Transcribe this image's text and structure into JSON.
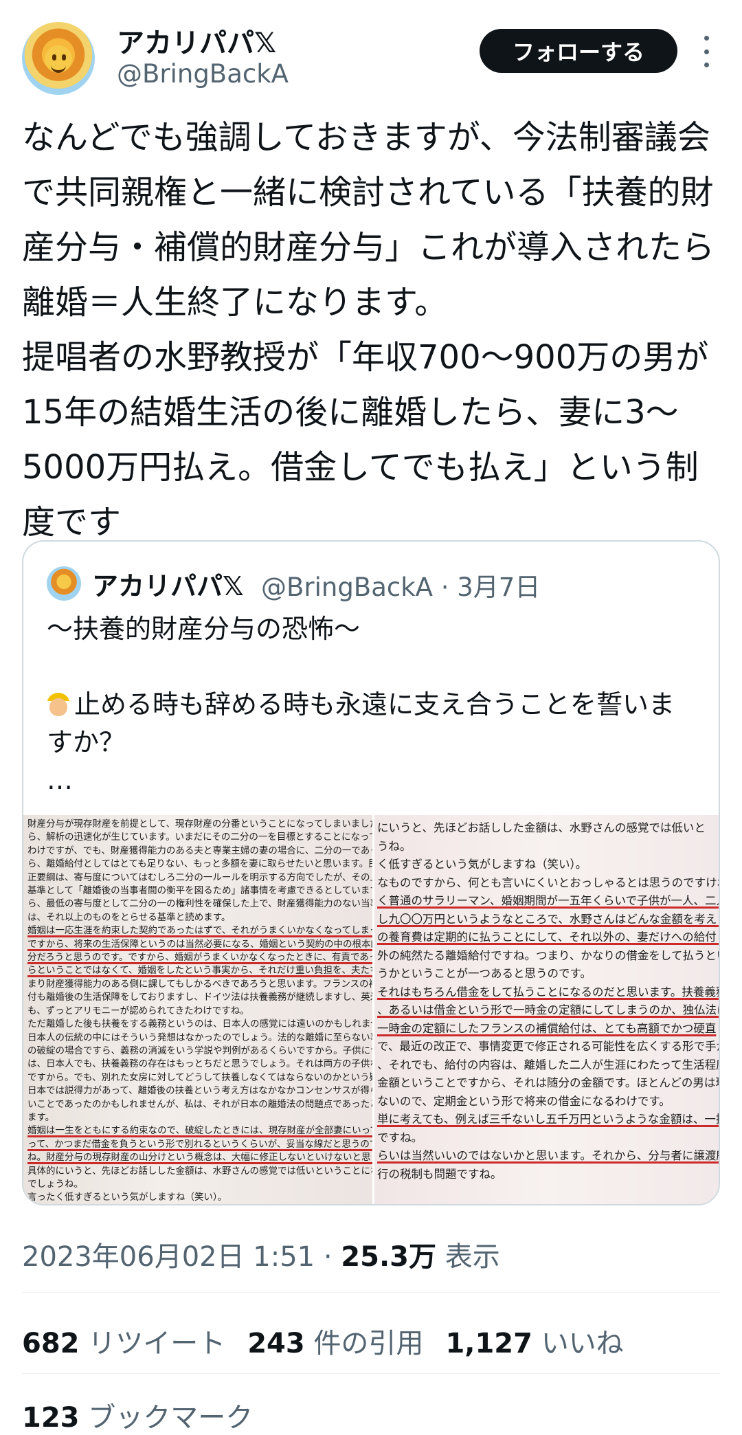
{
  "author": {
    "display_name": "アカリパパ𝕏",
    "handle": "@BringBackA"
  },
  "follow_button_label": "フォローする",
  "tweet_text": "なんどでも強調しておきますが、今法制審議会で共同親権と一緒に検討されている「扶養的財産分与・補償的財産分与」これが導入されたら離婚＝人生終了になります。\n提唱者の水野教授が「年収700〜900万の男が15年の結婚生活の後に離婚したら、妻に3〜5000万円払え。借金してでも払え」という制度です",
  "quoted_tweet": {
    "display_name": "アカリパパ𝕏",
    "meta": "@BringBackA · 3月7日",
    "line1": "〜扶養的財産分与の恐怖〜",
    "line2": "止める時も辞める時も永遠に支え合うことを誓いますか？",
    "ellipsis": "…",
    "doc_left_lines": [
      "財産分与が現存財産を前提として、現存財産の分番ということになってしまいましたか",
      "ら、解析の迅速化が生じています。いまだにその二分の一を目標とすることになってい",
      "わけですが、でも、財産獲得能力のある夫と専業主婦の妻の場合に、二分の一であっ",
      "ら、離婚給付としてはとても足りない、もっと多額を妻に取らせたいと思います。民法",
      "正要綱は、寄与度についてはむしろ二分の一ルールを明示する方向でしたが、その上",
      "基準として「離婚後の当事者間の衡平を図るため」諸事情を考慮できるとしていますが",
      "ら、最低の寄与度として二分の一の権利性を確保した上で、財産獲得能力のない当事者",
      "は、それ以上のものをとらせる基準と読めます。",
      "婚姻は一応生涯を約束した契約であったはずで、それがうまくいかなくなってしまった",
      "ですから、将来の生活保障というのは当然必要になる、婚姻という契約の中の根本的な",
      "分だろうと思うのです。ですから、婚姻がうまくいかなくなったときに、有責であった",
      "らということではなくて、婚姻をしたという事実から、それだけ重い負担を、夫たち",
      "まり財産獲得能力のある側に課してもしかるべきであろうと思います。フランスの補償",
      "付も離婚後の生活保障をしておりますし、ドイツ法は扶養義務が継続しますし、英米法",
      "も、ずっとアリモニーが認められてきたわけですね。",
      "ただ離婚した後も扶養をする義務というのは、日本人の感覚には遠いのかもしれませ",
      "日本人の伝統の中にはそういう発想はなかったのでしょう。法的な離婚に至らない事実",
      "の破綻の場合ですら、義務の消滅をいう学説や判例があるくらいですから。子供につい",
      "は、日本人でも、扶養義務の存在はもっとちだと思うでしょう。それは両方の子供なわ",
      "ですから。でも、別れた女房に対してどうして扶養しなくてはならないのかという疑問",
      "日本では説得力があって、離婚後の扶養という考え方はなかなかコンセンサスが得られ",
      "いことであったのかもしれませんが、私は、それが日本の離婚法の問題点であったと思",
      "ます。",
      "婚姻は一生をともにする約束なので、破綻したときには、現存財産が全部妻にいってし",
      "って、かつまだ借金を負うという形で別れるというくらいが、妥当な線だと思うので",
      "ね。財産分与の現存財産の山分けという概念は、大幅に修正しないといけないと思う。",
      "具体的にいうと、先ほどお話しした金額は、水野さんの感覚では低いということになる",
      "でしょうね。",
      "言ったく低すぎるという気がしますね（笑い）。"
    ],
    "doc_right_lines": [
      "にいうと、先ほどお話しした金額は、水野さんの感覚では低いと",
      "うね。",
      "く低すぎるという気がしますね（笑い）。",
      "なものですから、何とも言いにくいとおっしゃるとは思うのですけれ",
      "く普通のサラリーマン、婚姻期間が一五年くらいで子供が一人、二人",
      "し九〇〇万円というようなところで、水野さんはどんな金額を考えら",
      "の養育費は定期的に払うことにして、それ以外の、妻だけへの給付と",
      "外の純然たる離婚給付ですね。つまり、かなりの借金をして払うとい",
      "うかということが一つあると思うのです。",
      "それはもちろん借金をして払うことになるのだと思います。扶養義務",
      "、あるいは借金という形で一時金の定額にしてしまうのか、独仏法に",
      "一時金の定額にしたフランスの補償給付は、とても高額でかつ硬直",
      "で、最近の改正で、事情変更で修正される可能性を広くする形で手が",
      "、それでも、給付の内容は、離婚した二人が生涯にわたって生活程度",
      "金額ということですから、それは随分の金額です。ほとんどの男は現",
      "ないので、定期金という形で将来の借金になるわけです。",
      "単に考えても、例えば三千ないし五千万円というような金額は、一括",
      "ですね。",
      "らいは当然いいのではないかと思います。それから、分与者に譲渡所",
      "行の税制も問題ですね。"
    ]
  },
  "timestamp": "2023年06月02日 1:51",
  "views_count": "25.3万",
  "views_label": "表示",
  "stats": {
    "retweets_count": "682",
    "retweets_label": "リツイート",
    "quotes_count": "243",
    "quotes_label": "件の引用",
    "likes_count": "1,127",
    "likes_label": "いいね",
    "bookmarks_count": "123",
    "bookmarks_label": "ブックマーク"
  }
}
